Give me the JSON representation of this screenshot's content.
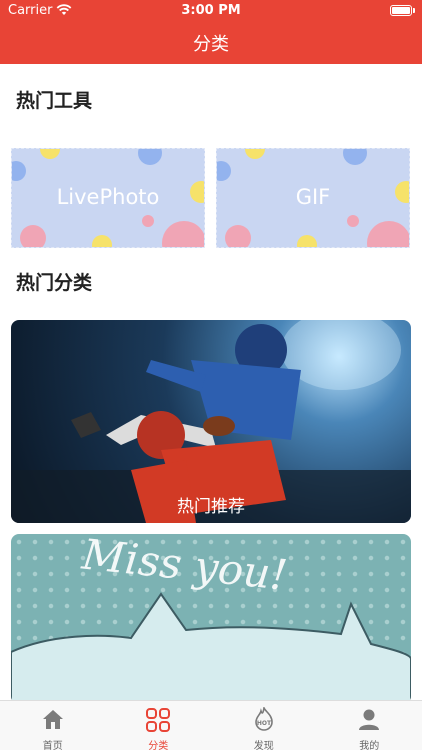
{
  "status_bar": {
    "carrier": "Carrier",
    "time": "3:00 PM"
  },
  "nav": {
    "title": "分类"
  },
  "hot_tools": {
    "title": "热门工具",
    "items": [
      {
        "label": "LivePhoto"
      },
      {
        "label": "GIF"
      }
    ]
  },
  "hot_categories": {
    "title": "热门分类",
    "items": [
      {
        "label": "热门推荐"
      },
      {
        "label": ""
      }
    ]
  },
  "tabbar": {
    "items": [
      {
        "label": "首页",
        "icon": "home-icon"
      },
      {
        "label": "分类",
        "icon": "grid-icon"
      },
      {
        "label": "发现",
        "icon": "hot-icon"
      },
      {
        "label": "我的",
        "icon": "profile-icon"
      }
    ],
    "active_index": 1
  },
  "colors": {
    "accent": "#e84436",
    "tool_card_bg": "#c9d6f2",
    "inactive_tab": "#666666"
  }
}
